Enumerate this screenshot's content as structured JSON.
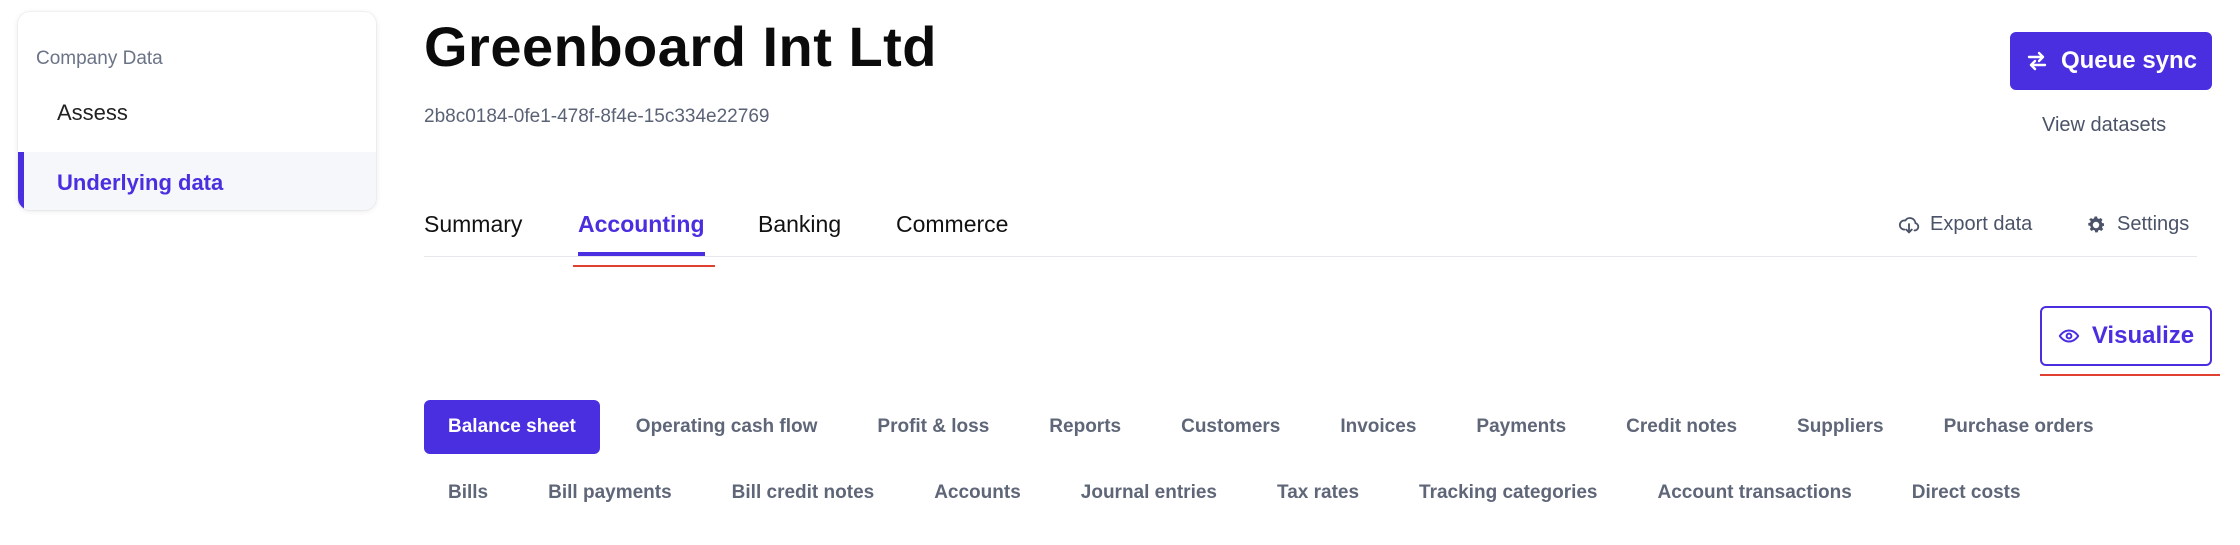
{
  "sidebar": {
    "section_label": "Company Data",
    "items": [
      {
        "label": "Assess"
      },
      {
        "label": "Underlying data"
      }
    ]
  },
  "header": {
    "title": "Greenboard Int Ltd",
    "company_id": "2b8c0184-0fe1-478f-8f4e-15c334e22769",
    "queue_sync_label": "Queue sync",
    "view_datasets_label": "View datasets"
  },
  "tabs": [
    {
      "label": "Summary"
    },
    {
      "label": "Accounting"
    },
    {
      "label": "Banking"
    },
    {
      "label": "Commerce"
    }
  ],
  "actions": {
    "export_label": "Export data",
    "settings_label": "Settings",
    "visualize_label": "Visualize"
  },
  "subtabs": {
    "row1": [
      "Balance sheet",
      "Operating cash flow",
      "Profit & loss",
      "Reports",
      "Customers",
      "Invoices",
      "Payments",
      "Credit notes",
      "Suppliers",
      "Purchase orders"
    ],
    "row2": [
      "Bills",
      "Bill payments",
      "Bill credit notes",
      "Accounts",
      "Journal entries",
      "Tax rates",
      "Tracking categories",
      "Account transactions",
      "Direct costs"
    ]
  },
  "colors": {
    "accent": "#4a2fe0",
    "annotation_red": "#e0402f"
  }
}
